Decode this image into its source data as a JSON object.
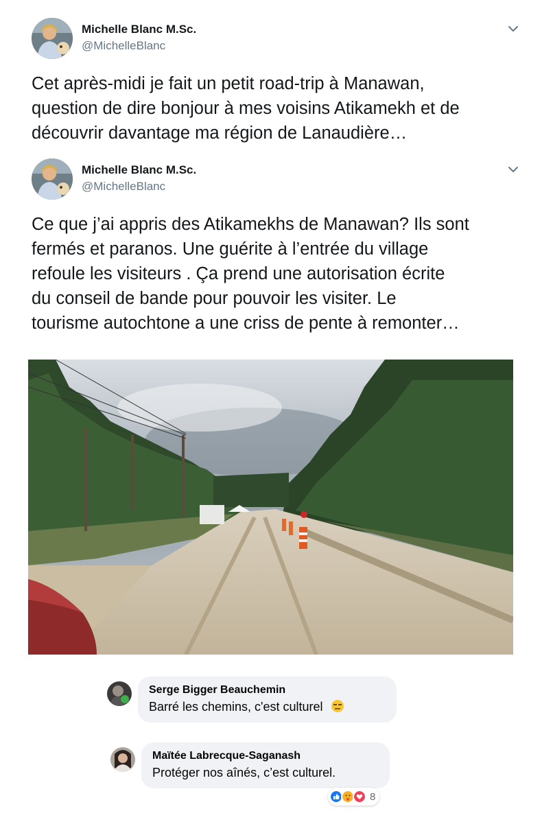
{
  "tweets": [
    {
      "author_name": "Michelle Blanc M.Sc.",
      "author_handle": "@MichelleBlanc",
      "text_lines": [
        "Cet après-midi je fait un petit road-trip à Manawan,",
        "question de dire bonjour à mes voisins Atikamekh et de",
        "découvrir davantage ma région de Lanaudière…"
      ]
    },
    {
      "author_name": "Michelle Blanc M.Sc.",
      "author_handle": "@MichelleBlanc",
      "text_lines": [
        "Ce que j’ai appris des Atikamekhs de Manawan? Ils sont",
        "fermés et paranos. Une guérite à l’entrée du village",
        "refoule les visiteurs . Ça prend une autorisation écrite",
        "du conseil de bande pour pouvoir les visiter. Le",
        "tourisme autochtone a une criss de pente à remonter…"
      ]
    }
  ],
  "photo": {
    "description_icon": "road-photo"
  },
  "comments": [
    {
      "name": "Serge Bigger Beauchemin",
      "text": "Barré les chemins, c'est culturel",
      "emoji": "unamused-face-icon"
    },
    {
      "name": "Maïtée Labrecque-Saganash",
      "text": "Protéger nos aînés, c’est culturel."
    }
  ],
  "reactions": {
    "icons": [
      "like-icon",
      "care-icon",
      "love-icon"
    ],
    "count": "8"
  },
  "colors": {
    "handle": "#657786",
    "bubble": "#f0f2f5",
    "like": "#1877f2",
    "love": "#f33e58",
    "care": "#f7b125"
  }
}
